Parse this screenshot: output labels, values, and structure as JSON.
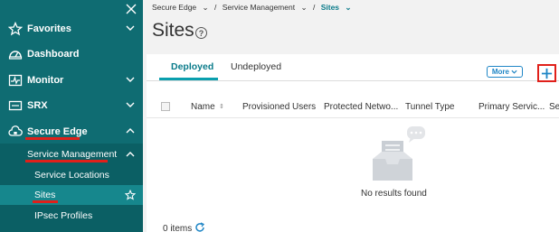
{
  "sidebar": {
    "items": [
      {
        "label": "Favorites",
        "icon": "star-icon"
      },
      {
        "label": "Dashboard",
        "icon": "dashboard-icon"
      },
      {
        "label": "Monitor",
        "icon": "monitor-icon"
      },
      {
        "label": "SRX",
        "icon": "srx-icon"
      },
      {
        "label": "Secure Edge",
        "icon": "cloud-lock-icon"
      }
    ],
    "sub_header": "Service Management",
    "sub_items": [
      "Service Locations",
      "Sites",
      "IPsec Profiles"
    ]
  },
  "breadcrumb": {
    "level1": "Secure Edge",
    "level2": "Service Management",
    "current": "Sites"
  },
  "page": {
    "title": "Sites"
  },
  "tabs": [
    {
      "label": "Deployed",
      "active": true
    },
    {
      "label": "Undeployed",
      "active": false
    }
  ],
  "toolbar": {
    "more_label": "More",
    "add_label": "+"
  },
  "table": {
    "columns": [
      "Name",
      "Provisioned Users",
      "Protected Netwo...",
      "Tunnel Type",
      "Primary Servic...",
      "Se"
    ],
    "empty_text": "No results found"
  },
  "footer": {
    "items_count": "0 items"
  },
  "colors": {
    "sidebar": "#0f6c72",
    "accent": "#0a9fae",
    "highlight": "#e0201a",
    "link": "#1f86c6"
  }
}
